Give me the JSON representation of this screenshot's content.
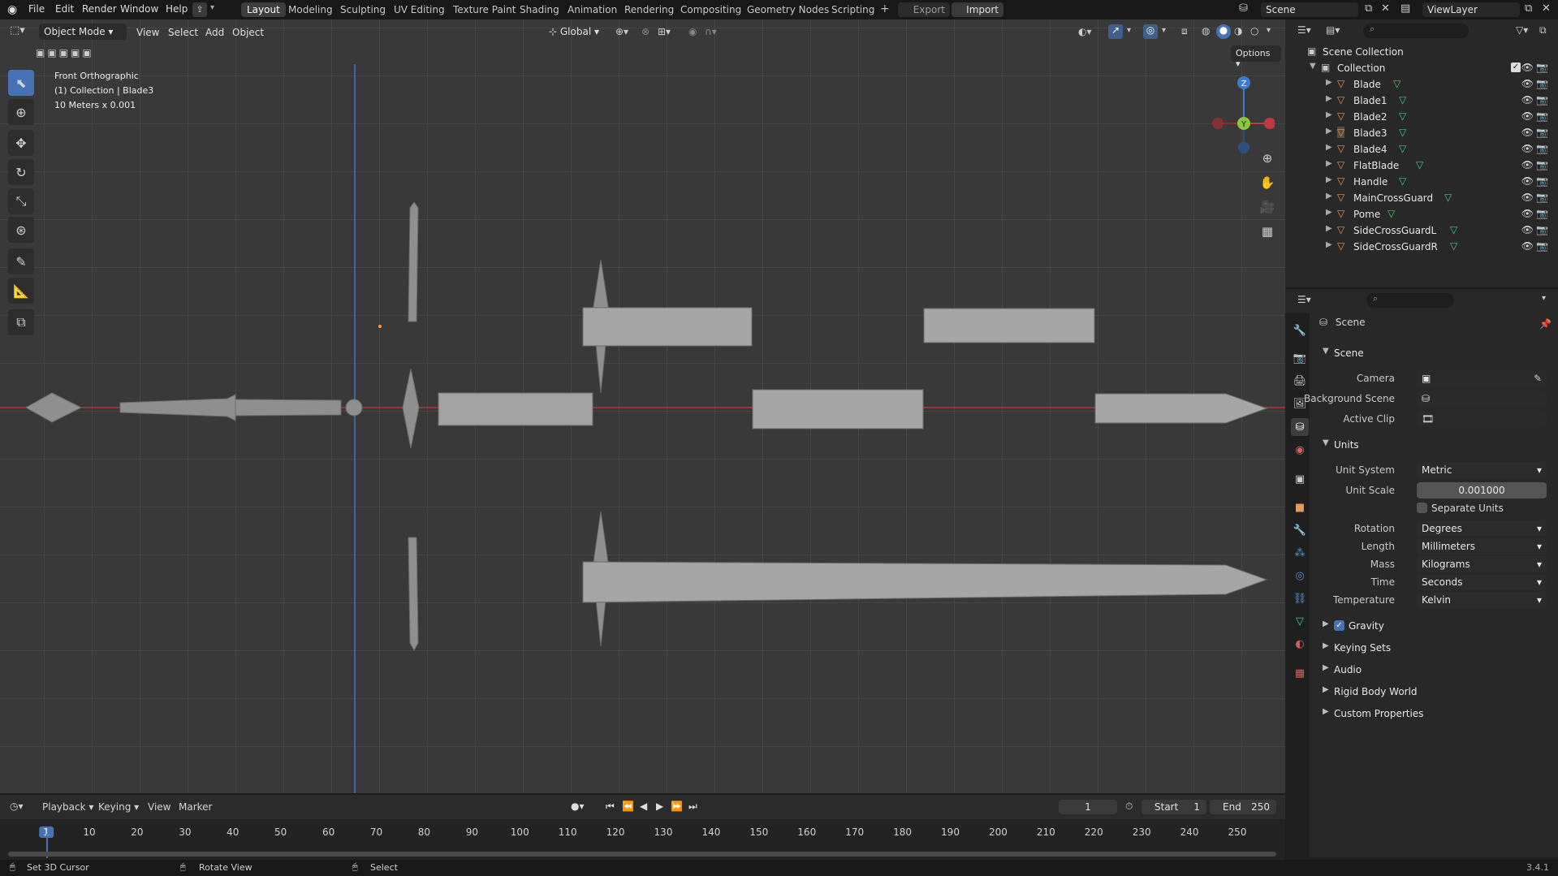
{
  "topbar": {
    "menus": [
      "File",
      "Edit",
      "Render",
      "Window",
      "Help"
    ],
    "workspaces": [
      "Layout",
      "Modeling",
      "Sculpting",
      "UV Editing",
      "Texture Paint",
      "Shading",
      "Animation",
      "Rendering",
      "Compositing",
      "Geometry Nodes",
      "Scripting"
    ],
    "active_workspace": "Layout",
    "export_label": "Export",
    "import_label": "Import",
    "scene_name": "Scene",
    "viewlayer_name": "ViewLayer"
  },
  "viewport": {
    "mode": "Object Mode",
    "menus": [
      "View",
      "Select",
      "Add",
      "Object"
    ],
    "transform_orientation": "Global",
    "options_label": "Options",
    "overlay_text": {
      "view_name": "Front Orthographic",
      "collection_info": "(1) Collection | Blade3",
      "scale_info": "10 Meters x 0.001"
    }
  },
  "outliner": {
    "root": "Scene Collection",
    "collection": "Collection",
    "objects": [
      "Blade",
      "Blade1",
      "Blade2",
      "Blade3",
      "Blade4",
      "FlatBlade",
      "Handle",
      "MainCrossGuard",
      "Pome",
      "SideCrossGuardL",
      "SideCrossGuardR"
    ]
  },
  "properties": {
    "header": "Scene",
    "scene_section": "Scene",
    "camera_label": "Camera",
    "background_scene_label": "Background Scene",
    "active_clip_label": "Active Clip",
    "units_section": "Units",
    "unit_system_label": "Unit System",
    "unit_system": "Metric",
    "unit_scale_label": "Unit Scale",
    "unit_scale": "0.001000",
    "separate_units_label": "Separate Units",
    "rotation_label": "Rotation",
    "rotation": "Degrees",
    "length_label": "Length",
    "length": "Millimeters",
    "mass_label": "Mass",
    "mass": "Kilograms",
    "time_label": "Time",
    "time": "Seconds",
    "temperature_label": "Temperature",
    "temperature": "Kelvin",
    "collapsed_sections": [
      "Gravity",
      "Keying Sets",
      "Audio",
      "Rigid Body World",
      "Custom Properties"
    ]
  },
  "timeline": {
    "menus": [
      "Playback",
      "Keying",
      "View",
      "Marker"
    ],
    "current_frame": "1",
    "start_label": "Start",
    "start": "1",
    "end_label": "End",
    "end": "250",
    "ruler": [
      "1",
      "10",
      "20",
      "30",
      "40",
      "50",
      "60",
      "70",
      "80",
      "90",
      "100",
      "110",
      "120",
      "130",
      "140",
      "150",
      "160",
      "170",
      "180",
      "190",
      "200",
      "210",
      "220",
      "230",
      "240",
      "250"
    ]
  },
  "statusbar": {
    "left": "Set 3D Cursor",
    "middle": "Rotate View",
    "right": "Select",
    "version": "3.4.1"
  },
  "gizmo": {
    "z": "Z",
    "y": "Y"
  },
  "colors": {
    "accent": "#4772b3",
    "x_axis": "#c0393f",
    "y_axis": "#8cc63f",
    "z_axis": "#3d7bd1",
    "active_frame": "#4772b3"
  }
}
